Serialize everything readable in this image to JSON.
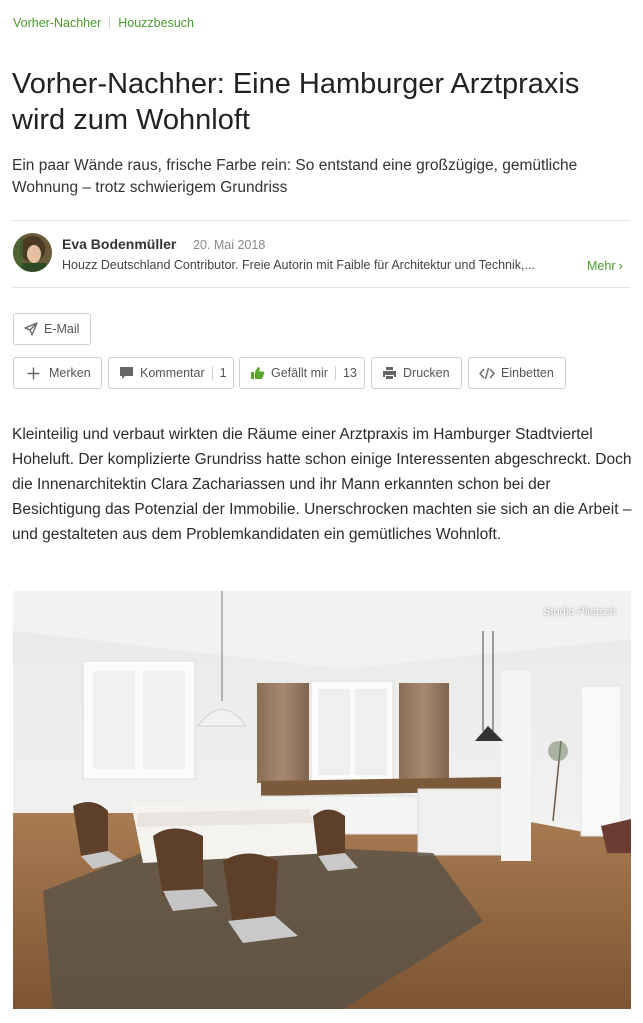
{
  "breadcrumb": {
    "item1": "Vorher-Nachher",
    "item2": "Houzzbesuch"
  },
  "article": {
    "title": "Vorher-Nachher: Eine Hamburger Arztpraxis wird zum Wohnloft",
    "subtitle": "Ein paar Wände raus, frische Farbe rein: So entstand eine großzügige, gemütliche Wohnung – trotz schwierigem Grundriss",
    "body": "Kleinteilig und verbaut wirkten die Räume einer Arztpraxis im Hamburger Stadtviertel Hoheluft. Der komplizierte Grundriss hatte schon einige Interessenten abgeschreckt. Doch die Innenarchitektin Clara Zachariassen und ihr Mann erkannten schon bei der Besichtigung das Potenzial der Immobilie. Unerschrocken machten sie sich an die Arbeit – und gestalteten aus dem Problemkandidaten ein gemütliches Wohnloft."
  },
  "author": {
    "name": "Eva Bodenmüller",
    "date": "20. Mai 2018",
    "bio": "Houzz Deutschland Contributor. Freie Autorin mit Faible für Architektur und Technik,...",
    "more_label": "Mehr"
  },
  "actions": {
    "email": "E-Mail",
    "save": "Merken",
    "comment": "Kommentar",
    "comment_count": "1",
    "like": "Gefällt mir",
    "like_count": "13",
    "print": "Drucken",
    "embed": "Einbetten"
  },
  "photo": {
    "credit": "Studio Plietsch"
  },
  "colors": {
    "accent": "#4a9a2c",
    "like_icon": "#5aa52c",
    "border": "#cfcfcf"
  },
  "icons": {
    "email": "paper-plane-icon",
    "save": "plus-icon",
    "comment": "speech-bubble-icon",
    "like": "thumbs-up-icon",
    "print": "printer-icon",
    "embed": "code-icon",
    "more": "chevron-right-icon"
  }
}
